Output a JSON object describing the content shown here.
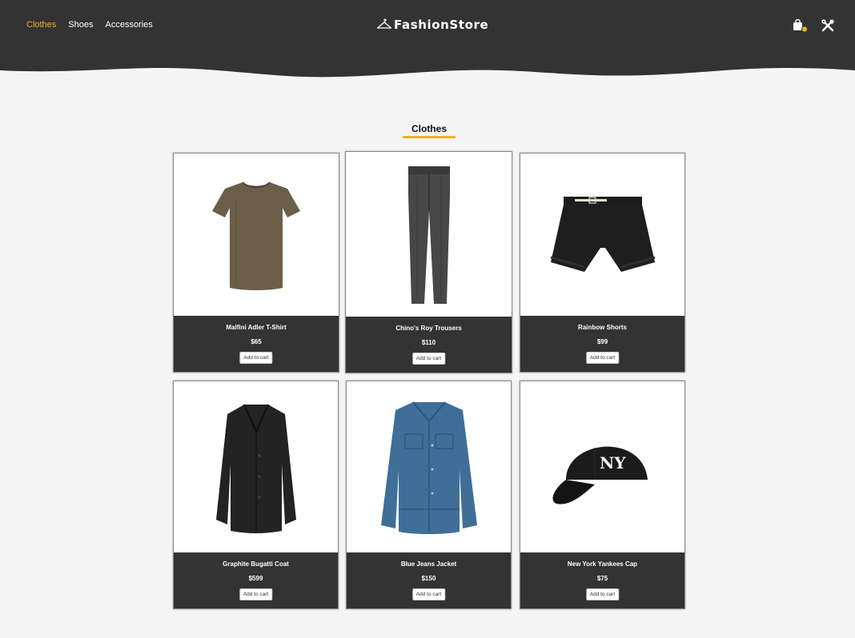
{
  "nav": {
    "items": [
      {
        "label": "Clothes",
        "active": true
      },
      {
        "label": "Shoes",
        "active": false
      },
      {
        "label": "Accessories",
        "active": false
      }
    ]
  },
  "brand": {
    "name": "FashionStore"
  },
  "colors": {
    "header": "#333333",
    "accent": "#e9b125",
    "background": "#f5f5f5"
  },
  "icons": {
    "brand": "hanger-icon",
    "cart": "shopping-bag-icon",
    "settings": "tools-icon"
  },
  "section": {
    "title": "Clothes"
  },
  "products": [
    {
      "name": "Malfini Adler T-Shirt",
      "price": "$65",
      "button": "Add to cart"
    },
    {
      "name": "Chino's Roy Trousers",
      "price": "$110",
      "button": "Add to cart"
    },
    {
      "name": "Rainbow Shorts",
      "price": "$99",
      "button": "Add to cart"
    },
    {
      "name": "Graphite Bugatti Coat",
      "price": "$599",
      "button": "Add to cart"
    },
    {
      "name": "Blue Jeans Jacket",
      "price": "$150",
      "button": "Add to cart"
    },
    {
      "name": "New York Yankees Cap",
      "price": "$75",
      "button": "Add to cart"
    }
  ]
}
